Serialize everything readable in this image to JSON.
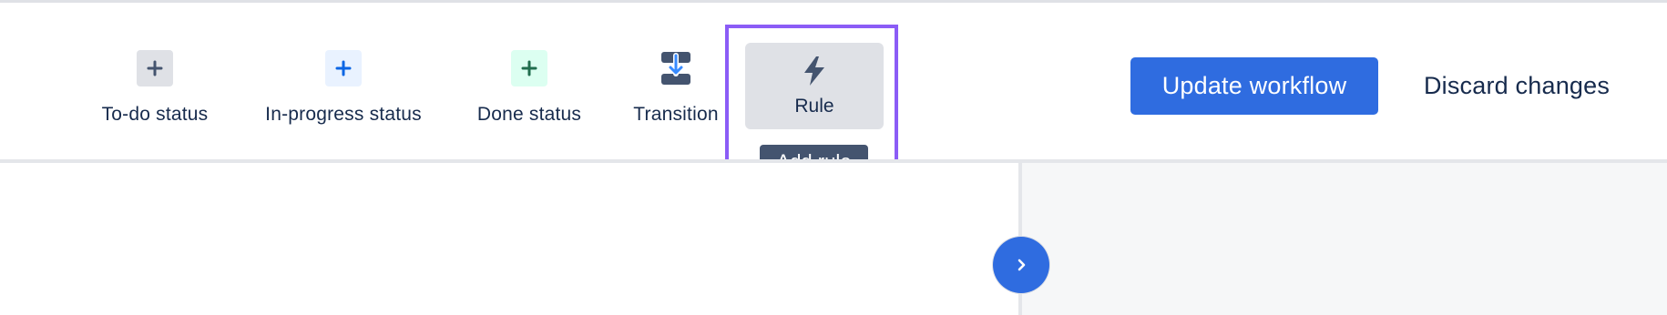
{
  "toolbar": {
    "items": [
      {
        "label": "To-do status",
        "icon": "plus-icon",
        "color": "#44546f",
        "bg": "#dfe1e6"
      },
      {
        "label": "In-progress status",
        "icon": "plus-icon",
        "color": "#0c66e4",
        "bg": "#e9f2ff"
      },
      {
        "label": "Done status",
        "icon": "plus-icon",
        "color": "#216e4e",
        "bg": "#dcfff1"
      },
      {
        "label": "Transition",
        "icon": "transition-icon",
        "color": "#44546f"
      },
      {
        "label": "Rule",
        "icon": "lightning-icon",
        "color": "#44546f"
      }
    ],
    "tooltip": "Add rule"
  },
  "actions": {
    "update_label": "Update workflow",
    "discard_label": "Discard changes"
  },
  "colors": {
    "primary": "#2f6ce0",
    "highlight": "#8b5cf6",
    "tooltip_bg": "#44546f"
  },
  "canvas": {
    "expand_icon": "chevron-right-icon"
  }
}
